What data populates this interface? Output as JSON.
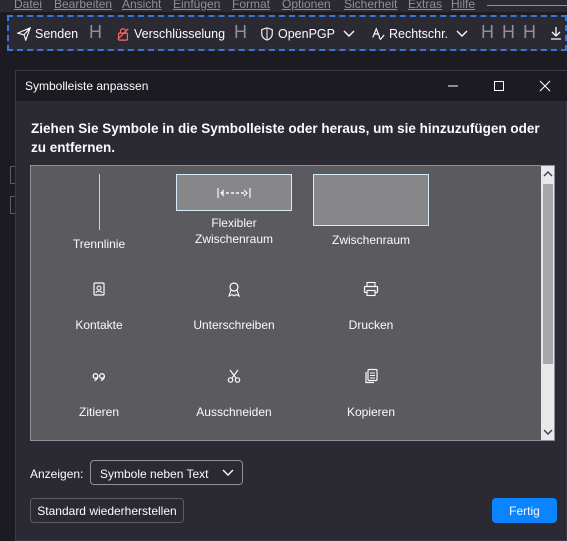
{
  "menubar": {
    "items": [
      "Datei",
      "Bearbeiten",
      "Ansicht",
      "Einfügen",
      "Format",
      "Optionen",
      "Sicherheit",
      "Extras",
      "Hilfe"
    ]
  },
  "toolbar": {
    "send_label": "Senden",
    "encryption_label": "Verschlüsselung",
    "openpgp_label": "OpenPGP",
    "spelling_label": "Rechtschr.",
    "separator_glyph": "H"
  },
  "dialog": {
    "title": "Symbolleiste anpassen",
    "instructions": "Ziehen Sie Symbole in die Symbolleiste oder heraus, um sie hinzuzufügen oder zu entfernen.",
    "palette": {
      "separator_label": "Trennlinie",
      "flexible_space_label": "Flexibler Zwischenraum",
      "space_label": "Zwischenraum",
      "contacts_label": "Kontakte",
      "sign_label": "Unterschreiben",
      "print_label": "Drucken",
      "quote_label": "Zitieren",
      "cut_label": "Ausschneiden",
      "copy_label": "Kopieren"
    },
    "show_label": "Anzeigen:",
    "show_value": "Symbole neben Text",
    "reset_button": "Standard wiederherstellen",
    "done_button": "Fertig"
  },
  "colors": {
    "accent": "#0a84ff",
    "dialog_bg": "#2b2a33",
    "palette_bg": "#5b5b5f"
  }
}
